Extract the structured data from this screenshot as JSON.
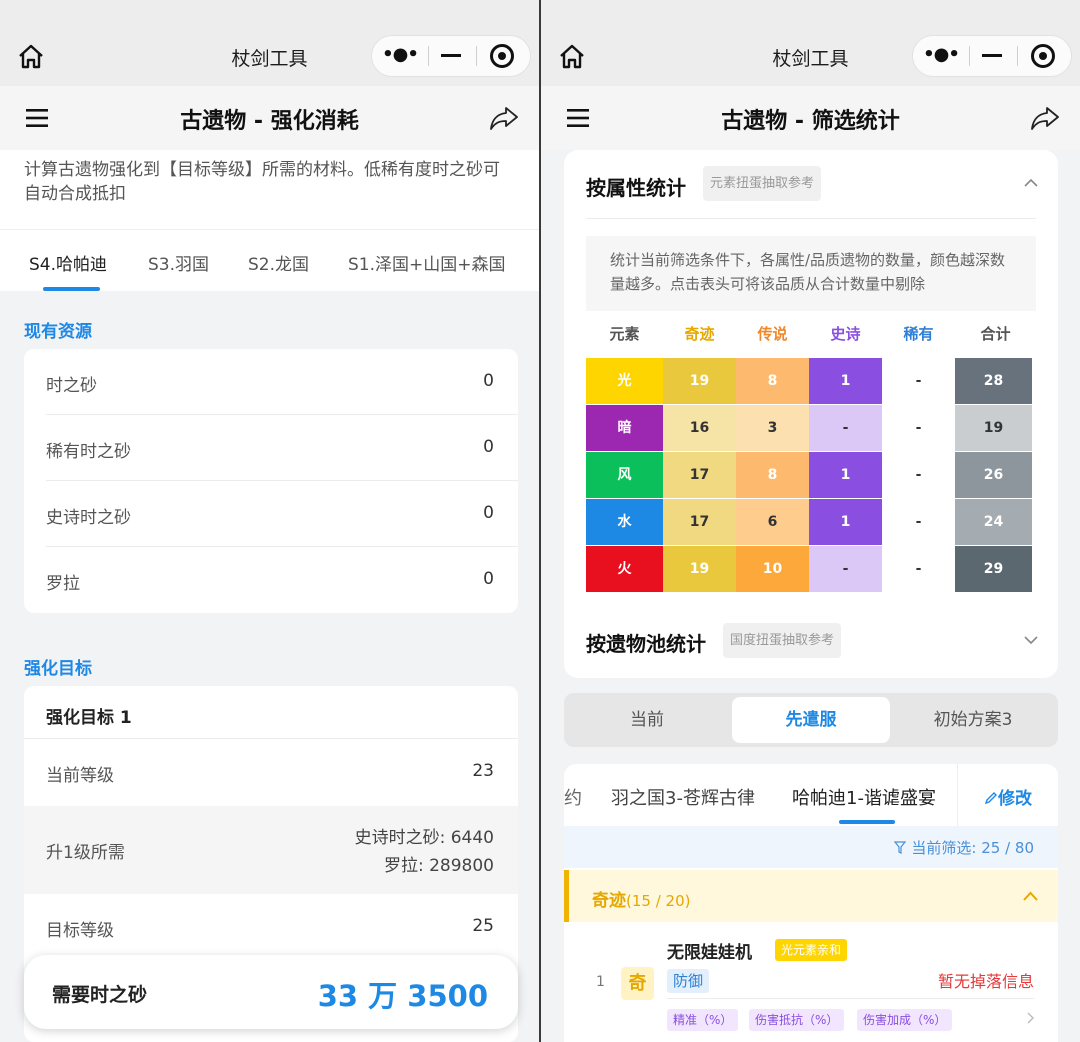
{
  "left": {
    "wx_title": "杖剑工具",
    "nav_title": "古遗物 - 强化消耗",
    "description": "计算古遗物强化到【目标等级】所需的材料。低稀有度时之砂可自动合成抵扣",
    "tabs": [
      "S4.哈帕迪",
      "S3.羽国",
      "S2.龙国",
      "S1.泽国+山国+森国"
    ],
    "resources_title": "现有资源",
    "resources": [
      {
        "label": "时之砂",
        "value": "0"
      },
      {
        "label": "稀有时之砂",
        "value": "0"
      },
      {
        "label": "史诗时之砂",
        "value": "0"
      },
      {
        "label": "罗拉",
        "value": "0"
      }
    ],
    "target_title": "强化目标",
    "target": {
      "header": "强化目标 1",
      "current_label": "当前等级",
      "current_value": "23",
      "need_label": "升1级所需",
      "need_line1": "史诗时之砂: 6440",
      "need_line2": "罗拉: 289800",
      "goal_label": "目标等级",
      "goal_value": "25"
    },
    "bottom": {
      "label": "需要时之砂",
      "value": "33 万 3500"
    }
  },
  "right": {
    "wx_title": "杖剑工具",
    "nav_title": "古遗物 - 筛选统计",
    "attr_title": "按属性统计",
    "attr_tag": "元素扭蛋抽取参考",
    "info": "统计当前筛选条件下，各属性/品质遗物的数量，颜色越深数量越多。点击表头可将该品质从合计数量中剔除",
    "headers": [
      "元素",
      "奇迹",
      "传说",
      "史诗",
      "稀有",
      "合计"
    ],
    "rows": [
      {
        "element": "光",
        "values": [
          "19",
          "8",
          "1",
          "-",
          "28"
        ]
      },
      {
        "element": "暗",
        "values": [
          "16",
          "3",
          "-",
          "-",
          "19"
        ]
      },
      {
        "element": "风",
        "values": [
          "17",
          "8",
          "1",
          "-",
          "26"
        ]
      },
      {
        "element": "水",
        "values": [
          "17",
          "6",
          "1",
          "-",
          "24"
        ]
      },
      {
        "element": "火",
        "values": [
          "19",
          "10",
          "-",
          "-",
          "29"
        ]
      }
    ],
    "pool_title": "按遗物池统计",
    "pool_tag": "国度扭蛋抽取参考",
    "segments": [
      "当前",
      "先遣服",
      "初始方案3"
    ],
    "pool_tabs": [
      "约",
      "羽之国3-苍辉古律",
      "哈帕迪1-谐谑盛宴"
    ],
    "edit_label": "修改",
    "filter_text": "当前筛选: 25 / 80",
    "group_label": "奇迹",
    "group_count": "(15 / 20)",
    "relic": {
      "index": "1",
      "badge": "奇",
      "name": "无限娃娃机",
      "tag": "光元素亲和",
      "type": "防御",
      "status": "暂无掉落信息",
      "stats": [
        "精准（%）",
        "伤害抵抗（%）",
        "伤害加成（%）"
      ]
    }
  },
  "colors": {
    "accent": "#1e88e5",
    "miracle": "#e6a800",
    "legend": "#f0882a",
    "epic": "#8a4fe0",
    "rare": "#2f7fd6",
    "status_red": "#e5393a"
  }
}
